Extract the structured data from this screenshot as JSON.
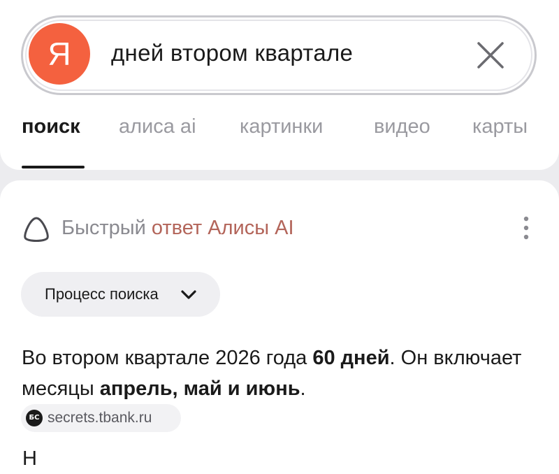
{
  "search": {
    "logo_letter": "Я",
    "query": "дней втором квартале"
  },
  "tabs": [
    {
      "label": "поиск",
      "active": true
    },
    {
      "label": "алиса ai",
      "active": false
    },
    {
      "label": "картинки",
      "active": false
    },
    {
      "label": "видео",
      "active": false
    },
    {
      "label": "карты",
      "active": false
    }
  ],
  "answer": {
    "header_part1": "Быстрый ",
    "header_part2": "ответ Алисы AI",
    "process_label": "Процесс поиска",
    "text_1": "Во втором квартале 2026 года ",
    "text_bold_1": "60 дней",
    "text_2": ". Он включает месяцы ",
    "text_bold_2": "апрель, май и июнь",
    "text_3": ".",
    "source_label": "secrets.tbank.ru",
    "source_favicon_text": "БС",
    "next_line_fragment": "Н"
  },
  "colors": {
    "logo": "#f4613f",
    "accent_text": "#b3655a",
    "muted_text": "#9a9aa0"
  },
  "icons": {
    "clear": "close-icon",
    "alice": "alice-ring-icon",
    "more": "more-vertical-icon",
    "chevron": "chevron-down-icon"
  }
}
